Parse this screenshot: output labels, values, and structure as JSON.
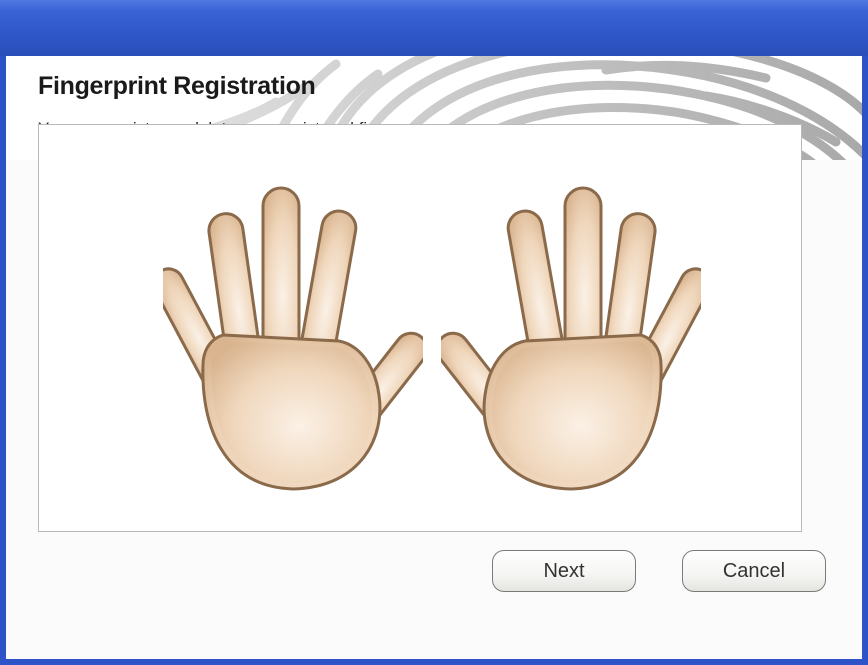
{
  "header": {
    "title": "Fingerprint Registration",
    "subtitle": "You may register or delete your registered finger."
  },
  "buttons": {
    "next_label": "Next",
    "cancel_label": "Cancel"
  },
  "icons": {
    "left_hand": "left-hand-icon",
    "right_hand": "right-hand-icon",
    "header_background": "fingerprint-icon"
  },
  "colors": {
    "titlebar": "#2c54c8",
    "skin": "#e8c9a6",
    "skin_outline": "#8a6a4a"
  }
}
